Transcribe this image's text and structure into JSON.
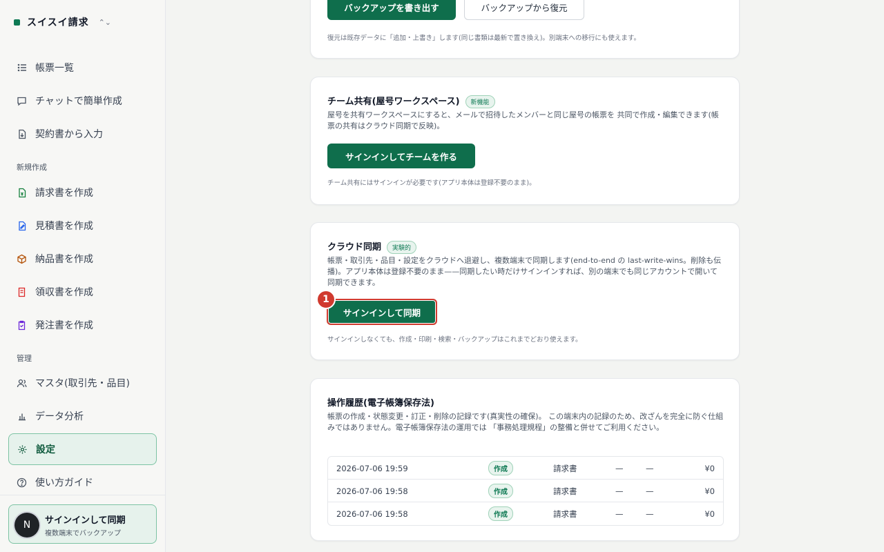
{
  "app": {
    "name": "スイスイ請求",
    "switch_icon": "chevron-updown-icon"
  },
  "sidebar": {
    "top_items": [
      {
        "label": "帳票一覧",
        "icon": "list-icon"
      },
      {
        "label": "チャットで簡単作成",
        "icon": "chat-icon"
      },
      {
        "label": "契約書から入力",
        "icon": "document-import-icon"
      }
    ],
    "section_new": "新規作成",
    "new_items": [
      {
        "label": "請求書を作成",
        "icon": "invoice-icon"
      },
      {
        "label": "見積書を作成",
        "icon": "quote-icon"
      },
      {
        "label": "納品書を作成",
        "icon": "package-icon"
      },
      {
        "label": "領収書を作成",
        "icon": "receipt-icon"
      },
      {
        "label": "発注書を作成",
        "icon": "clipboard-icon"
      }
    ],
    "section_admin": "管理",
    "admin_items": [
      {
        "label": "マスタ(取引先・品目)",
        "icon": "users-icon"
      },
      {
        "label": "データ分析",
        "icon": "chart-icon"
      },
      {
        "label": "設定",
        "icon": "gear-icon",
        "active": true
      },
      {
        "label": "使い方ガイド",
        "icon": "help-icon"
      }
    ],
    "user": {
      "avatar": "N",
      "title": "サインインして同期",
      "subtitle": "複数端末でバックアップ"
    }
  },
  "backup": {
    "export_button": "バックアップを書き出す",
    "restore_button": "バックアップから復元",
    "note": "復元は既存データに「追加・上書き」します(同じ書類は最新で置き換え)。別端末への移行にも使えます。"
  },
  "team": {
    "title": "チーム共有(屋号ワークスペース)",
    "badge": "新機能",
    "desc": "屋号を共有ワークスペースにすると、メールで招待したメンバーと同じ屋号の帳票を 共同で作成・編集できます(帳票の共有はクラウド同期で反映)。",
    "button": "サインインしてチームを作る",
    "note": "チーム共有にはサインインが必要です(アプリ本体は登録不要のまま)。"
  },
  "cloud": {
    "title": "クラウド同期",
    "badge": "実験的",
    "desc": "帳票・取引先・品目・設定をクラウドへ退避し、複数端末で同期します(end-to-end の last-write-wins。削除も伝播)。アプリ本体は登録不要のまま——同期したい時だけサインインすれば、別の端末でも同じアカウントで開いて同期できます。",
    "button": "サインインして同期",
    "marker": "1",
    "note": "サインインしなくても、作成・印刷・検索・バックアップはこれまでどおり使えます。"
  },
  "history": {
    "title": "操作履歴(電子帳簿保存法)",
    "desc": "帳票の作成・状態変更・訂正・削除の記録です(真実性の確保)。 この端末内の記録のため、改ざんを完全に防ぐ仕組みではありません。電子帳簿保存法の運用では 「事務処理規程」の整備と併せてご利用ください。",
    "rows": [
      {
        "date": "2026-07-06 19:59",
        "op": "作成",
        "type": "請求書",
        "d1": "—",
        "d2": "—",
        "amount": "¥0"
      },
      {
        "date": "2026-07-06 19:58",
        "op": "作成",
        "type": "請求書",
        "d1": "—",
        "d2": "—",
        "amount": "¥0"
      },
      {
        "date": "2026-07-06 19:58",
        "op": "作成",
        "type": "請求書",
        "d1": "—",
        "d2": "—",
        "amount": "¥0"
      }
    ]
  }
}
